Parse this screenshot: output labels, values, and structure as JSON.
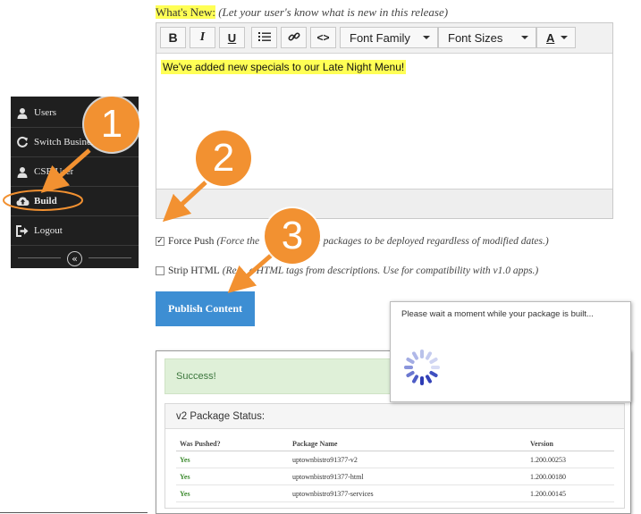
{
  "sidebar": {
    "items": [
      {
        "label": "Users",
        "icon": "user-icon"
      },
      {
        "label": "Switch Business",
        "icon": "refresh-icon"
      },
      {
        "label": "CSR User",
        "icon": "user-icon"
      },
      {
        "label": "Build",
        "icon": "cloud-upload-icon",
        "highlighted": true
      },
      {
        "label": "Logout",
        "icon": "logout-icon"
      }
    ],
    "collapse_glyph": "«"
  },
  "editor": {
    "label": "What's New:",
    "hint": "(Let your user's know what is new in this release)",
    "toolbar": {
      "bold": "B",
      "italic": "I",
      "underline": "U",
      "code": "<>",
      "font_family": "Font Family",
      "font_sizes": "Font Sizes",
      "font_color": "A"
    },
    "content": "We've added new specials to our Late Night Menu!"
  },
  "force_push": {
    "checked": true,
    "check_glyph": "✓",
    "label": "Force Push",
    "hint_start": "(Force the",
    "hint_end": "live packages to be deployed regardless of modified dates.)"
  },
  "strip_html": {
    "checked": false,
    "label": "Strip HTML",
    "hint_start": "(Re",
    "hint_end": "e HTML tags from descriptions. Use for compatibility with v1.0 apps.)"
  },
  "publish_button": "Publish Content",
  "result": {
    "success": "Success!",
    "package_status_title": "v2 Package Status:",
    "columns": [
      "Was Pushed?",
      "Package Name",
      "Version"
    ],
    "rows": [
      [
        "Yes",
        "uptownbistro91377-v2",
        "1.200.00253"
      ],
      [
        "Yes",
        "uptownbistro91377-html",
        "1.200.00180"
      ],
      [
        "Yes",
        "uptownbistro91377-services",
        "1.200.00145"
      ]
    ]
  },
  "loading_dialog": {
    "message": "Please wait a moment while your package is built..."
  },
  "callouts": [
    "1",
    "2",
    "3"
  ],
  "colors": {
    "callout_orange": "#f29131",
    "highlight_yellow": "#ffff55",
    "sidebar_bg": "#1f1f1f",
    "publish_blue": "#3d8ed3",
    "success_green": "#dff0d8",
    "yes_green": "#3c8a2e"
  }
}
